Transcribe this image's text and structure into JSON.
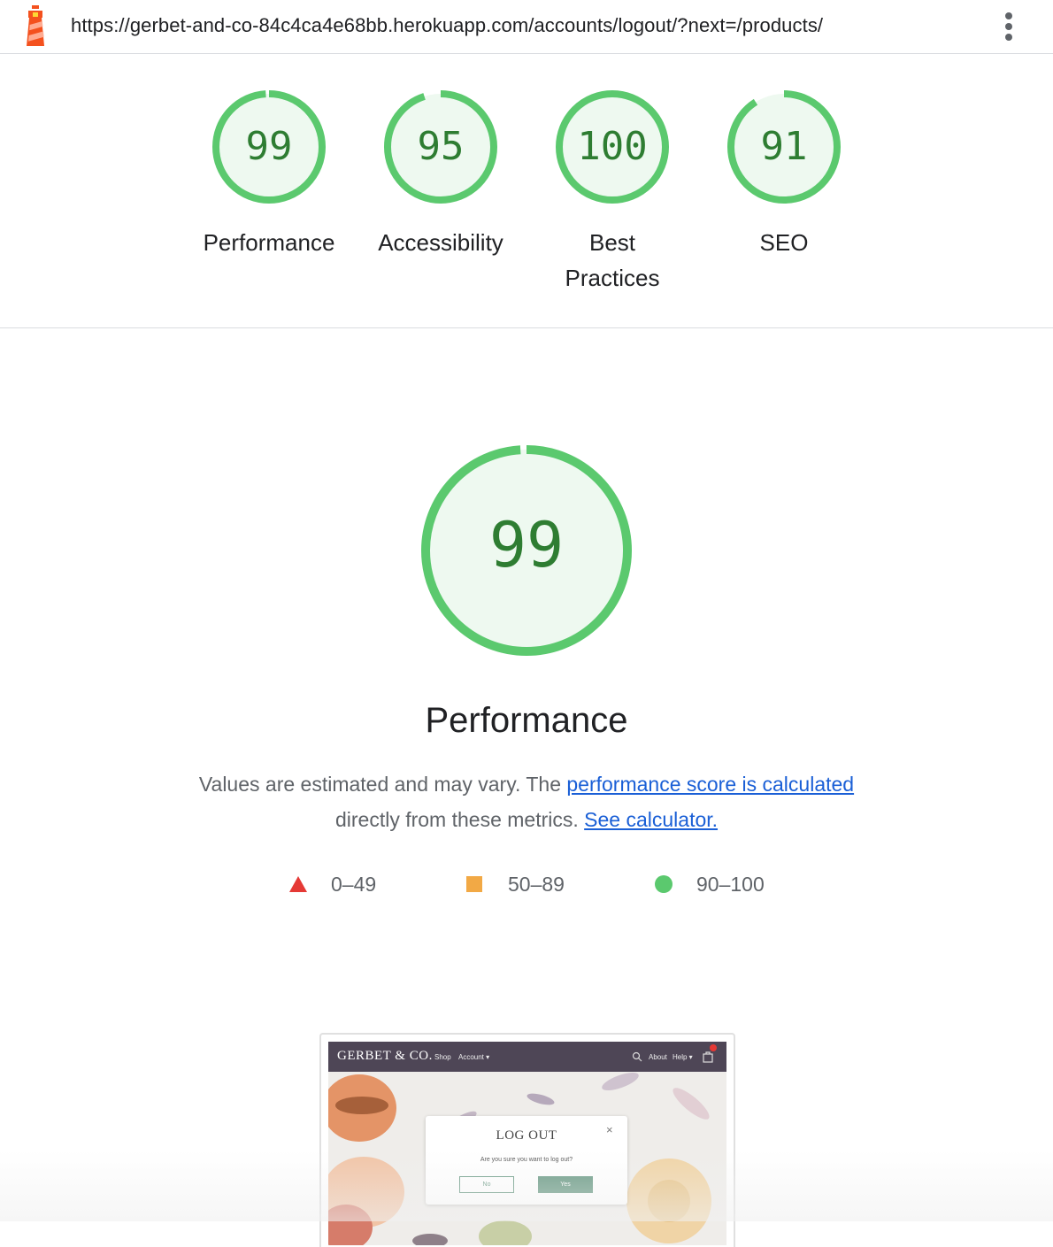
{
  "topbar": {
    "url": "https://gerbet-and-co-84c4ca4e68bb.herokuapp.com/accounts/logout/?next=/products/",
    "logo_icon": "lighthouse-icon",
    "menu_icon": "kebab-menu-icon"
  },
  "colors": {
    "pass": "#0cce6b",
    "pass_ring": "#5bc96e",
    "pass_fill": "#eef9f0",
    "pass_text": "#2e7d32",
    "average": "#f2a945",
    "fail": "#e53935",
    "link": "#1a5fd6"
  },
  "scores": [
    {
      "label": "Performance",
      "score": "99",
      "value": 99
    },
    {
      "label": "Accessibility",
      "score": "95",
      "value": 95
    },
    {
      "label": "Best Practices",
      "score": "100",
      "value": 100
    },
    {
      "label": "SEO",
      "score": "91",
      "value": 91
    }
  ],
  "performance": {
    "score": "99",
    "value": 99,
    "title": "Performance",
    "desc_prefix": "Values are estimated and may vary. The ",
    "desc_link": "performance score is calculated",
    "desc_middle": " directly from these metrics. ",
    "calc_link": "See calculator."
  },
  "legend": [
    {
      "range": "0–49",
      "shape": "triangle"
    },
    {
      "range": "50–89",
      "shape": "square"
    },
    {
      "range": "90–100",
      "shape": "circle"
    }
  ],
  "screenshot": {
    "brand": "GERBET & CO.",
    "nav_shop": "Shop",
    "nav_account": "Account ▾",
    "nav_about": "About",
    "nav_help": "Help ▾",
    "cart_count": "1",
    "modal_title": "LOG OUT",
    "modal_question": "Are you sure you want to log out?",
    "btn_no": "No",
    "btn_yes": "Yes",
    "close": "×"
  }
}
